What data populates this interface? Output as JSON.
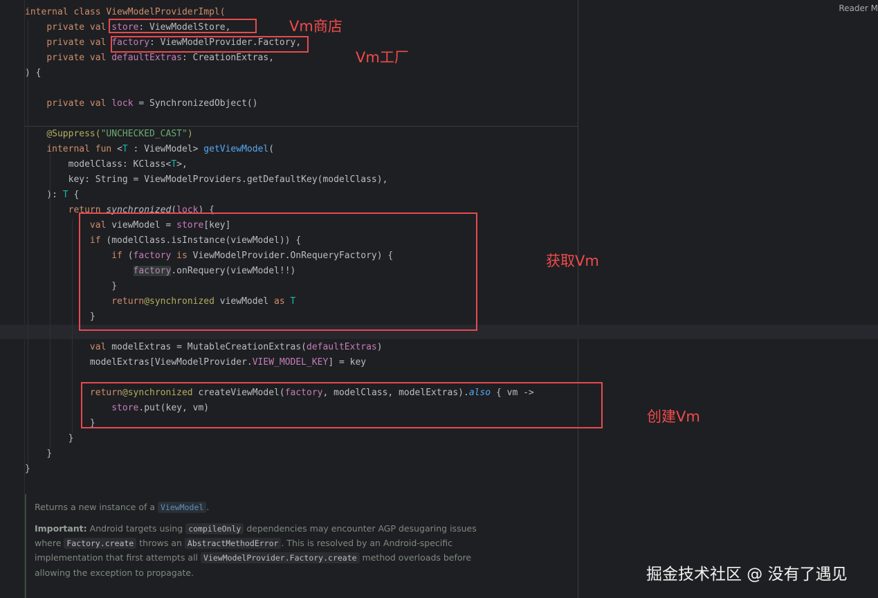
{
  "header": {
    "reader_mode_label": "Reader M"
  },
  "code_lines": {
    "l1": {
      "a": "internal class ViewModelProviderImpl("
    },
    "l2": {
      "a": "private val ",
      "b": "store",
      "c": ": ViewModelStore,"
    },
    "l3": {
      "a": "private val ",
      "b": "factory",
      "c": ": ViewModelProvider.Factory,"
    },
    "l4": {
      "a": "private val ",
      "b": "defaultExtras",
      "c": ": CreationExtras,"
    },
    "l5": {
      "a": ") {"
    },
    "l7": {
      "a": "private val ",
      "b": "lock",
      "c": " = SynchronizedObject()"
    },
    "l9": {
      "a": "@Suppress(",
      "b": "\"UNCHECKED_CAST\"",
      "c": ")"
    },
    "l10": {
      "a": "internal fun ",
      "b": "<",
      "c": "T",
      "d": " : ViewModel> ",
      "e": "getViewModel",
      "f": "("
    },
    "l11": {
      "a": "modelClass: KClass<",
      "b": "T",
      "c": ">,"
    },
    "l12": {
      "a": "key: String = ViewModelProviders.getDefaultKey(modelClass),"
    },
    "l13": {
      "a": "): ",
      "b": "T",
      "c": " {"
    },
    "l14": {
      "a": "return ",
      "b": "synchronized",
      "c": "(",
      "d": "lock",
      "e": ") {"
    },
    "l15": {
      "a": "val ",
      "b": "viewModel = ",
      "c": "store",
      "d": "[key]"
    },
    "l16": {
      "a": "if ",
      "b": "(modelClass.isInstance(viewModel)) {"
    },
    "l17": {
      "a": "if ",
      "b": "(",
      "c": "factory",
      "d": " is ",
      "e": "ViewModelProvider.OnRequeryFactory) {"
    },
    "l18": {
      "a": "factory",
      "b": ".onRequery(viewModel!!)"
    },
    "l19": {
      "a": "}"
    },
    "l20": {
      "a": "return",
      "b": "@synchronized",
      "c": " viewModel ",
      "d": "as ",
      "e": "T"
    },
    "l21": {
      "a": "}"
    },
    "l23": {
      "a": "val ",
      "b": "modelExtras = MutableCreationExtras(",
      "c": "defaultExtras",
      "d": ")"
    },
    "l24": {
      "a": "modelExtras[ViewModelProvider.",
      "b": "VIEW_MODEL_KEY",
      "c": "] = key"
    },
    "l26": {
      "a": "return",
      "b": "@synchronized",
      "c": " createViewModel(",
      "d": "factory",
      "e": ", modelClass, modelExtras).",
      "f": "also",
      "g": " { vm ->"
    },
    "l27": {
      "a": "store",
      "b": ".put(key, vm)"
    },
    "l28": {
      "a": "}"
    },
    "l29": {
      "a": "}"
    },
    "l30": {
      "a": "}"
    },
    "l31": {
      "a": "}"
    }
  },
  "annotations": {
    "store": "Vm商店",
    "factory": "Vm工厂",
    "get_vm": "获取Vm",
    "create_vm": "创建Vm"
  },
  "doc": {
    "line1_a": "Returns a new instance of a ",
    "line1_link": "ViewModel",
    "line1_b": ".",
    "important_label": "Important:",
    "line2_a": " Android targets using ",
    "line2_chip": "compileOnly",
    "line2_b": " dependencies may encounter AGP desugaring issues",
    "line3_a": "where ",
    "line3_chip1": "Factory.create",
    "line3_b": " throws an ",
    "line3_chip2": "AbstractMethodError",
    "line3_c": ". This is resolved by an Android-specific",
    "line4_a": "implementation that first attempts all ",
    "line4_chip": "ViewModelProvider.Factory.create",
    "line4_b": " method overloads before",
    "line5": "allowing the exception to propagate."
  },
  "watermark": "掘金技术社区 @ 没有了遇见",
  "colors": {
    "background": "#1e1f22",
    "keyword": "#cf8e6d",
    "property": "#c77dbb",
    "function": "#56a8f5",
    "type_param": "#16baac",
    "string": "#6aab73",
    "annotation": "#b3ae60",
    "highlight_box": "#e84a4f"
  }
}
